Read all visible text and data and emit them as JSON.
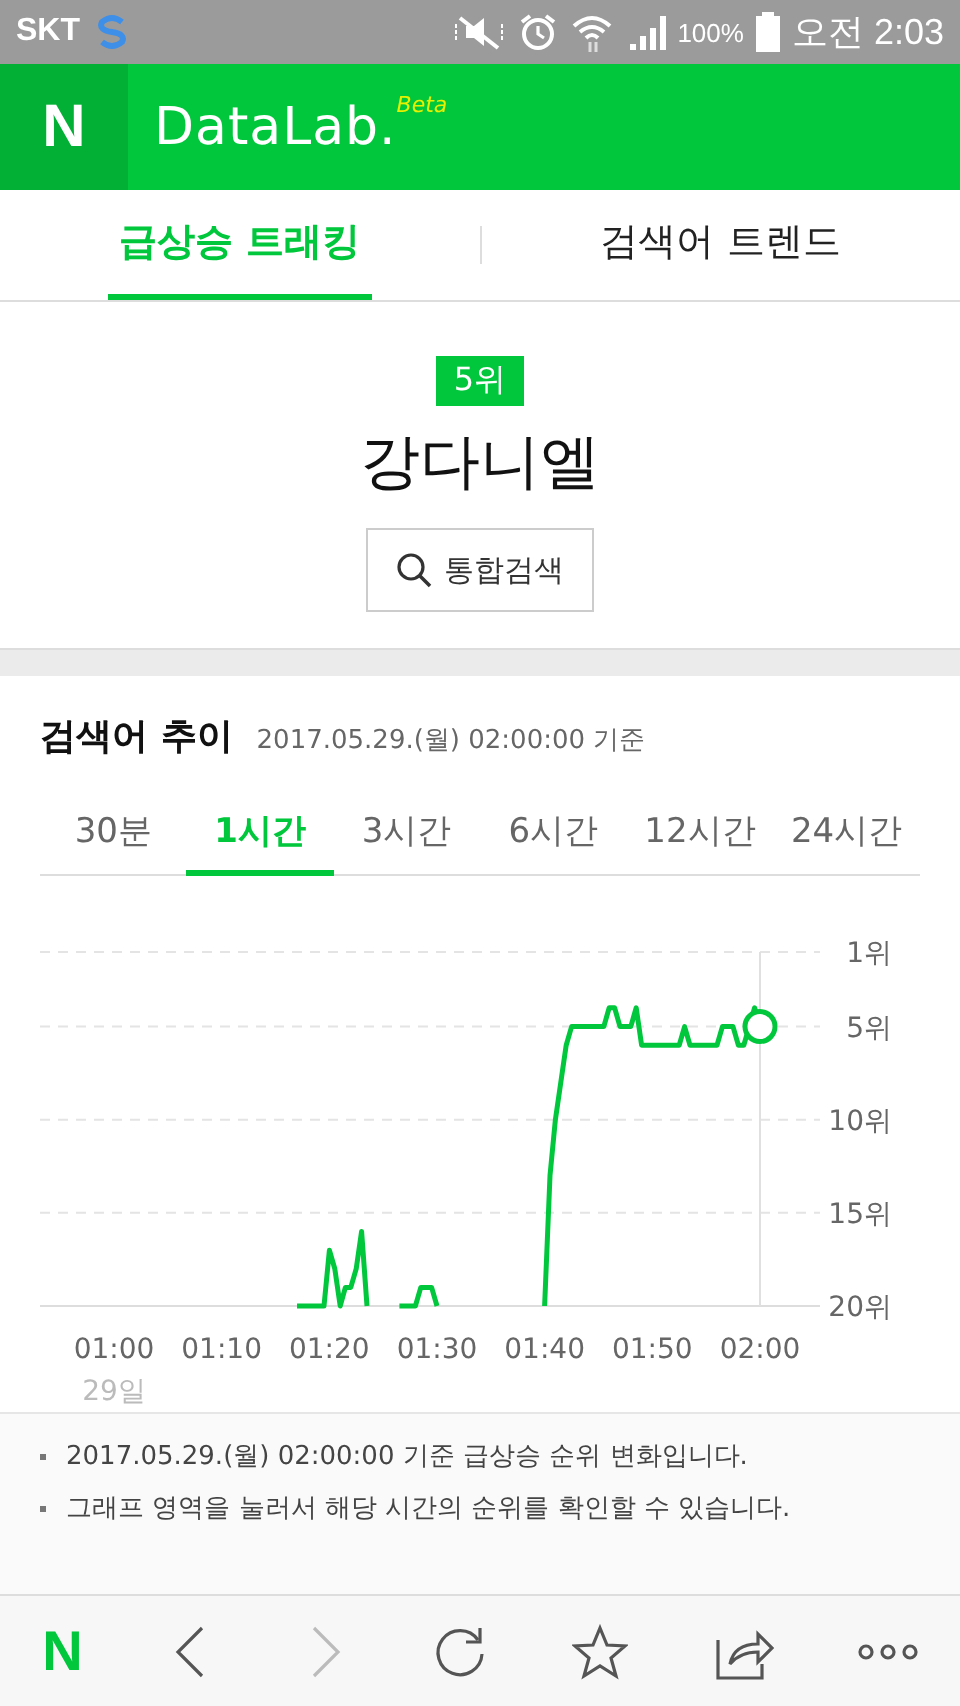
{
  "status_bar": {
    "carrier": "SKT",
    "battery": "100%",
    "time": "오전 2:03"
  },
  "header": {
    "logo": "N",
    "title": "DataLab.",
    "badge": "Beta"
  },
  "tabs": [
    {
      "label": "급상승 트래킹",
      "selected": true
    },
    {
      "label": "검색어 트렌드",
      "selected": false
    }
  ],
  "keyword": {
    "rank": "5위",
    "name": "강다니엘",
    "search_button": "통합검색"
  },
  "trend": {
    "title": "검색어 추이",
    "timestamp": "2017.05.29.(월) 02:00:00 기준",
    "periods": [
      {
        "label": "30분",
        "selected": false
      },
      {
        "label": "1시간",
        "selected": true
      },
      {
        "label": "3시간",
        "selected": false
      },
      {
        "label": "6시간",
        "selected": false
      },
      {
        "label": "12시간",
        "selected": false
      },
      {
        "label": "24시간",
        "selected": false
      }
    ],
    "date_label": "29일",
    "chart_data": {
      "type": "line",
      "categories": [
        "01:00",
        null,
        null,
        null,
        null,
        null,
        null,
        null,
        null,
        null,
        null,
        null,
        null,
        null,
        null,
        null,
        null,
        null,
        null,
        null,
        "01:10",
        null,
        null,
        null,
        null,
        null,
        null,
        null,
        null,
        null,
        null,
        null,
        null,
        null,
        null,
        null,
        null,
        null,
        null,
        null,
        "01:20",
        null,
        null,
        null,
        null,
        null,
        null,
        null,
        null,
        null,
        null,
        null,
        null,
        null,
        null,
        null,
        null,
        null,
        null,
        null,
        "01:30",
        null,
        null,
        null,
        null,
        null,
        null,
        null,
        null,
        null,
        null,
        null,
        null,
        null,
        null,
        null,
        null,
        null,
        null,
        null,
        "01:40",
        null,
        null,
        null,
        null,
        null,
        null,
        null,
        null,
        null,
        null,
        null,
        null,
        null,
        null,
        null,
        null,
        null,
        null,
        null,
        "01:50",
        null,
        null,
        null,
        null,
        null,
        null,
        null,
        null,
        null,
        null,
        null,
        null,
        null,
        null,
        null,
        null,
        null,
        null,
        null,
        "02:00"
      ],
      "series": [
        {
          "color": "#00c73c",
          "values": [
            null,
            null,
            null,
            null,
            null,
            null,
            null,
            null,
            null,
            null,
            null,
            null,
            null,
            null,
            null,
            null,
            null,
            null,
            null,
            null,
            null,
            null,
            null,
            null,
            null,
            null,
            null,
            null,
            null,
            null,
            null,
            null,
            null,
            null,
            20,
            20,
            20,
            20,
            20,
            20,
            17,
            18,
            20,
            19,
            19,
            18,
            16,
            20,
            null,
            null,
            null,
            null,
            null,
            20,
            20,
            20,
            20,
            19,
            19,
            19,
            20,
            null,
            null,
            null,
            null,
            null,
            null,
            null,
            null,
            null,
            null,
            null,
            null,
            null,
            null,
            null,
            null,
            null,
            null,
            null,
            20,
            13,
            10,
            8,
            6,
            5,
            5,
            5,
            5,
            5,
            5,
            5,
            4,
            4,
            5,
            5,
            5,
            4,
            6,
            6,
            6,
            6,
            6,
            6,
            6,
            6,
            5,
            6,
            6,
            6,
            6,
            6,
            6,
            5,
            5,
            5,
            6,
            6,
            5,
            4,
            5
          ]
        }
      ],
      "ylim": [
        20,
        1
      ],
      "grid": true,
      "yticks": [
        {
          "value": 1,
          "label": "1위"
        },
        {
          "value": 5,
          "label": "5위"
        },
        {
          "value": 10,
          "label": "10위"
        },
        {
          "value": 15,
          "label": "15위"
        },
        {
          "value": 20,
          "label": "20위"
        }
      ]
    }
  },
  "notes": [
    "2017.05.29.(월) 02:00:00 기준 급상승 순위 변화입니다.",
    "그래프 영역을 눌러서 해당 시간의 순위를 확인할 수 있습니다."
  ],
  "browser_bar": {
    "logo": "N",
    "forward_disabled": true
  }
}
